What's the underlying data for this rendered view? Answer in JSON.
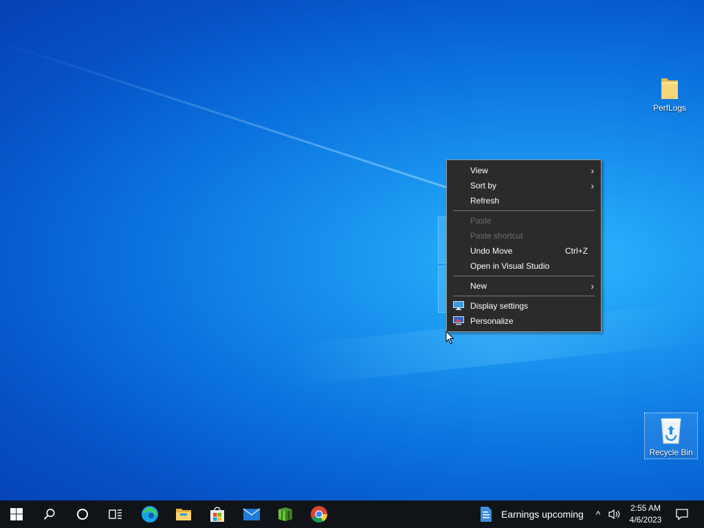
{
  "desktop": {
    "icons": [
      {
        "label": "PerfLogs"
      },
      {
        "label": "Recycle Bin"
      }
    ]
  },
  "context_menu": {
    "items": [
      {
        "label": "View",
        "has_submenu": true
      },
      {
        "label": "Sort by",
        "has_submenu": true
      },
      {
        "label": "Refresh"
      },
      {
        "label": "Paste",
        "disabled": true
      },
      {
        "label": "Paste shortcut",
        "disabled": true
      },
      {
        "label": "Undo Move",
        "shortcut": "Ctrl+Z"
      },
      {
        "label": "Open in Visual Studio"
      },
      {
        "label": "New",
        "has_submenu": true
      },
      {
        "label": "Display settings",
        "icon": "display-icon"
      },
      {
        "label": "Personalize",
        "icon": "personalize-icon"
      }
    ],
    "arrow_glyph": "›",
    "colors": {
      "background": "#2b2b2b",
      "disabled_text": "#6d6d6d"
    }
  },
  "taskbar": {
    "apps": [
      {
        "icon": "windows-start-icon"
      },
      {
        "icon": "search-icon"
      },
      {
        "icon": "cortana-icon"
      },
      {
        "icon": "task-view-icon"
      },
      {
        "icon": "edge-icon"
      },
      {
        "icon": "file-explorer-icon"
      },
      {
        "icon": "microsoft-store-icon"
      },
      {
        "icon": "mail-icon"
      },
      {
        "icon": "minecraft-icon"
      },
      {
        "icon": "chrome-icon"
      }
    ],
    "news_widget": {
      "text": "Earnings upcoming"
    },
    "tray": {
      "time": "2:55 AM",
      "date": "4/6/2023",
      "chevron_glyph": "^"
    }
  }
}
